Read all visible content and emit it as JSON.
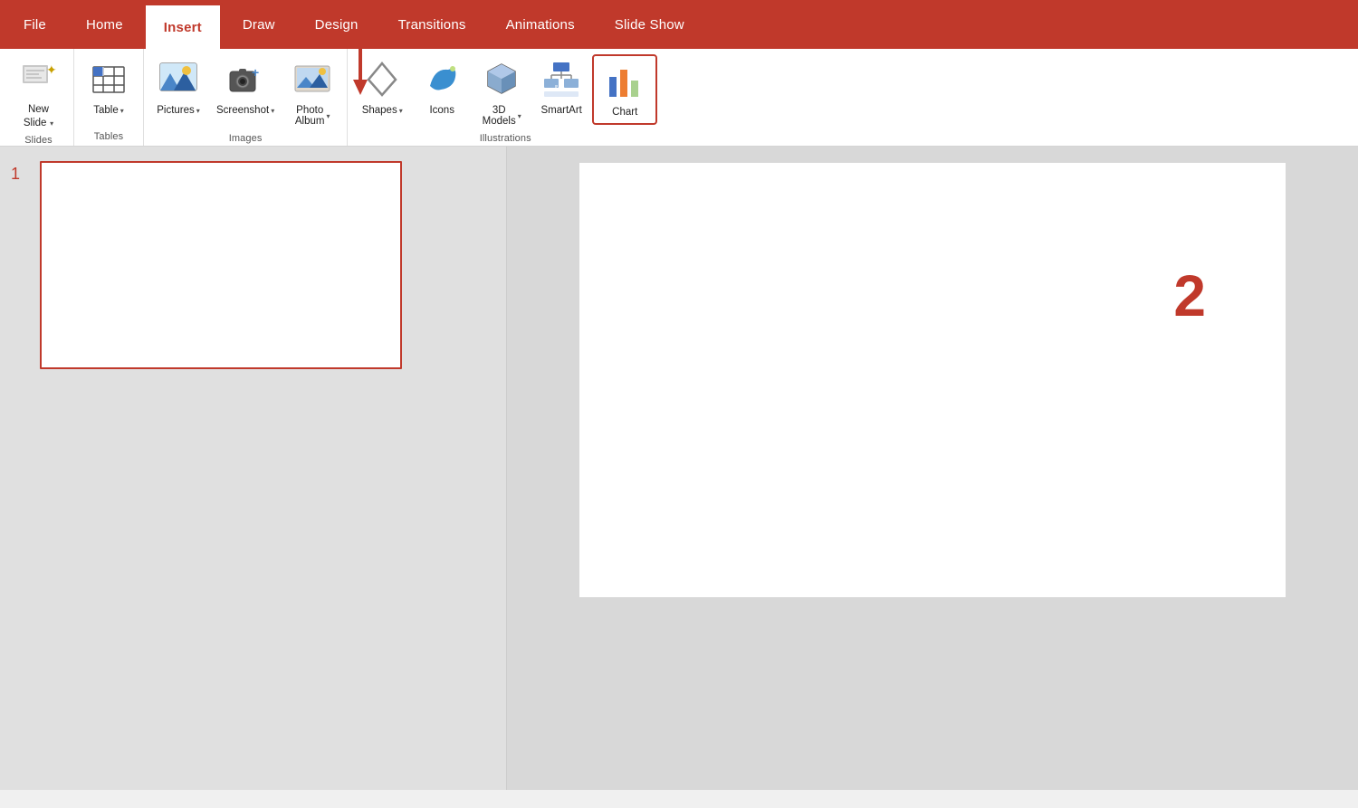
{
  "tabs": [
    {
      "id": "file",
      "label": "File",
      "active": false
    },
    {
      "id": "home",
      "label": "Home",
      "active": false
    },
    {
      "id": "insert",
      "label": "Insert",
      "active": true
    },
    {
      "id": "draw",
      "label": "Draw",
      "active": false
    },
    {
      "id": "design",
      "label": "Design",
      "active": false
    },
    {
      "id": "transitions",
      "label": "Transitions",
      "active": false
    },
    {
      "id": "animations",
      "label": "Animations",
      "active": false
    },
    {
      "id": "slideshow",
      "label": "Slide Show",
      "active": false
    }
  ],
  "groups": {
    "slides": {
      "label": "Slides",
      "buttons": [
        {
          "id": "new-slide",
          "label": "New\nSlide",
          "has_arrow": true
        }
      ]
    },
    "tables": {
      "label": "Tables",
      "buttons": [
        {
          "id": "table",
          "label": "Table",
          "has_arrow": true
        }
      ]
    },
    "images": {
      "label": "Images",
      "buttons": [
        {
          "id": "pictures",
          "label": "Pictures",
          "has_arrow": true
        },
        {
          "id": "screenshot",
          "label": "Screenshot",
          "has_arrow": true
        },
        {
          "id": "photo-album",
          "label": "Photo\nAlbum",
          "has_arrow": true
        }
      ]
    },
    "illustrations": {
      "label": "Illustrations",
      "buttons": [
        {
          "id": "shapes",
          "label": "Shapes",
          "has_arrow": true
        },
        {
          "id": "icons",
          "label": "Icons",
          "has_arrow": false
        },
        {
          "id": "3d-models",
          "label": "3D\nModels",
          "has_arrow": true
        },
        {
          "id": "smartart",
          "label": "SmartArt",
          "has_arrow": false
        },
        {
          "id": "chart",
          "label": "Chart",
          "has_arrow": false,
          "highlighted": true
        }
      ]
    }
  },
  "slide": {
    "number": "1",
    "annotation": "2"
  },
  "colors": {
    "accent": "#c0392b",
    "highlight_border": "#c0392b",
    "ribbon_bg": "#c0392b",
    "white": "#ffffff"
  }
}
